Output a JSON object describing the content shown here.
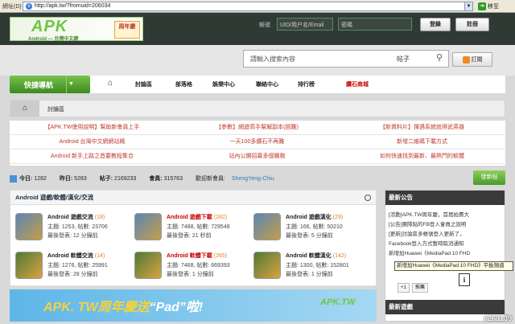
{
  "browser": {
    "label": "網址(D)",
    "url": "http://apk.tw/?fromuid=206034",
    "go": "移至"
  },
  "header": {
    "logo_text": "APK",
    "logo_sub": "Android — 台灣中文網",
    "anniv": "周年慶",
    "acct_label": "帳號",
    "user_placeholder": "UID/用户名/Email",
    "pass_placeholder": "密碼",
    "login": "登錄",
    "register": "註冊"
  },
  "search": {
    "placeholder": "請輸入搜索內容",
    "category": "帖子",
    "rss": "訂閱"
  },
  "nav": {
    "quick": "快捷導航",
    "items": [
      "討論區",
      "部落格",
      "娛樂中心",
      "聯絡中心",
      "排行榜",
      "鑽石商城"
    ]
  },
  "breadcrumb": {
    "current": "討論區"
  },
  "links": [
    "【APK.TW使用說明】幫助新會員上手",
    "【參數】網遊高手幫解副本(困難)",
    "【新資料片】揮遇系統就得武英雄",
    "Android 台灣中文網網站概",
    "一天100多鑽石不再難",
    "新增二維碼下載方式",
    "Android 新手上路之首要教程集合",
    "站內公開招募多個職務",
    "如何快速找到最新、最熱門的軟體"
  ],
  "stats": {
    "today_label": "今日:",
    "today": "1282",
    "yesterday_label": "昨日:",
    "yesterday": "5283",
    "posts_label": "帖子:",
    "posts": "2169233",
    "members_label": "會員:",
    "members": "315763",
    "welcome": "歡迎新會員:",
    "newuser": "ShengYeng-Chiu",
    "newpost": "發新帖"
  },
  "forum": {
    "title": "Android 遊戲/軟體/漢化/交流",
    "cells": [
      {
        "name": "Android 遊戲交流",
        "count": "(18)",
        "l1": "主題: 1253, 帖數: 23706",
        "l2": "最後發表: 12 分鐘前"
      },
      {
        "name": "Android 遊戲下載",
        "count": "(282)",
        "l1": "主題: 7488, 帖數: 729548",
        "l2": "最後發表: 21 秒前"
      },
      {
        "name": "Android 遊戲漢化",
        "count": "(29)",
        "l1": "主題: 166, 帖數: 50210",
        "l2": "最後發表: 5 分鐘前"
      },
      {
        "name": "Android 軟體交流",
        "count": "(14)",
        "l1": "主題: 1276, 帖數: 25991",
        "l2": "最後發表: 28 分鐘前"
      },
      {
        "name": "Android 軟體下載",
        "count": "(265)",
        "l1": "主題: 7468, 帖數: 669393",
        "l2": "最後發表: 1 分鐘前"
      },
      {
        "name": "Android 軟體漢化",
        "count": "(142)",
        "l1": "主題: 1300, 帖數: 152801",
        "l2": "最後發表: 1 分鐘前"
      }
    ]
  },
  "banner": {
    "text": "APK. TW周年慶送",
    "pad": "“Pad”啦!",
    "logo": "APK.TW"
  },
  "side": {
    "title": "最新公告",
    "items": [
      "[活動]APK.TW周年慶，首屆拍賣大",
      "[公告]團隊貼的FB登入會員之說明",
      "[更新]討論區多帳號登入更新了，",
      "Facebook登入方式暫時取消通知",
      "新增加Huawei《MediaPad 10 FHD"
    ],
    "tooltip": "新增加Huawei《MediaPad 10 FHD》平板頻道",
    "title2": "最新遊戲",
    "gplus": "+1",
    "share": "推薦"
  },
  "watermark": "#269139"
}
